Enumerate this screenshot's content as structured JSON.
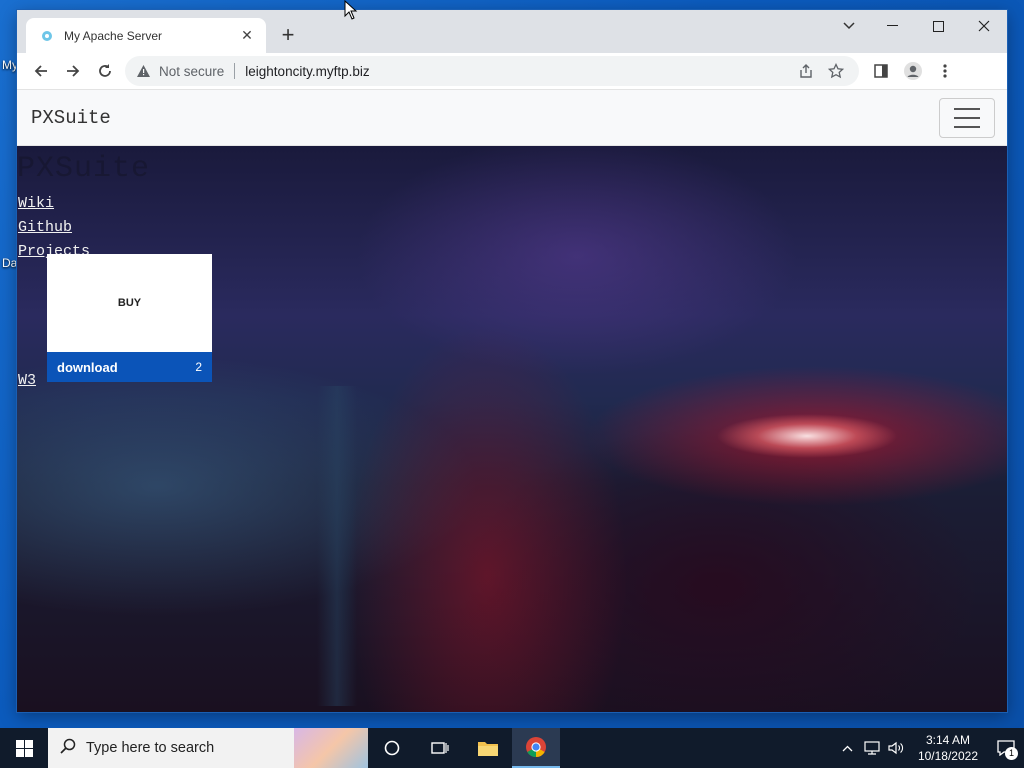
{
  "desktop": {
    "label_my": "My",
    "label_da": "Da"
  },
  "browser": {
    "tab_title": "My Apache Server",
    "newtab_glyph": "+",
    "address": {
      "security_text": "Not secure",
      "url": "leightoncity.myftp.biz"
    }
  },
  "page": {
    "brand": "PXSuite",
    "ghost_title": "PXSuite",
    "links": [
      "Wiki",
      "Github",
      "Projects"
    ],
    "w3_link": "W3",
    "card": {
      "buy_label": "BUY",
      "download_label": "download",
      "count": "2"
    },
    "accent_color": "#0b54b8"
  },
  "taskbar": {
    "search_placeholder": "Type here to search",
    "time": "3:14 AM",
    "date": "10/18/2022",
    "notification_count": "1",
    "colors": {
      "bar": "#101b2b",
      "active_underline": "#76b9ed"
    }
  }
}
